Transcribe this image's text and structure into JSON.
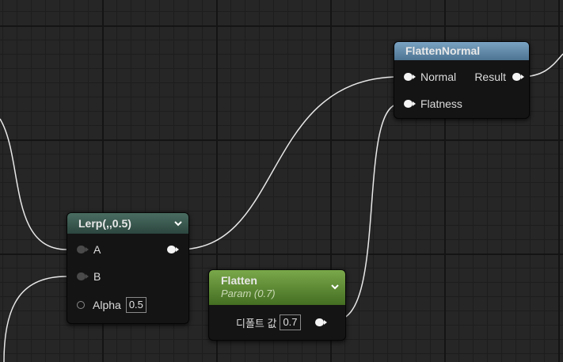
{
  "nodes": {
    "flatten_normal": {
      "title": "FlattenNormal",
      "inputs": [
        "Normal",
        "Flatness"
      ],
      "output": "Result"
    },
    "lerp": {
      "title": "Lerp(,,0.5)",
      "inputs": [
        "A",
        "B",
        "Alpha"
      ],
      "alpha_value": "0.5"
    },
    "flatten": {
      "title": "Flatten",
      "subtitle": "Param (0.7)",
      "default_label": "디폴트 값",
      "default_value": "0.7"
    }
  },
  "colors": {
    "background": "#262626",
    "flatten_normal_header": "#5f88a8",
    "flatten_header": "#5c8a30",
    "lerp_header": "#3b5a50"
  }
}
